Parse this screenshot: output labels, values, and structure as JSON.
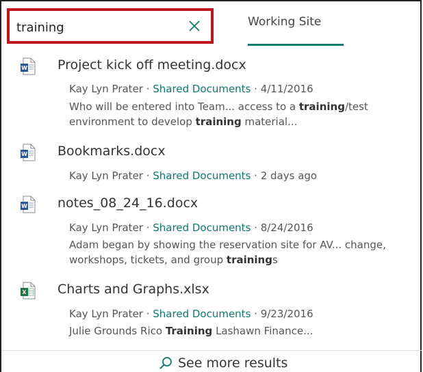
{
  "search": {
    "query": "training"
  },
  "tabs": {
    "working_site": "Working Site"
  },
  "results": [
    {
      "type": "word",
      "title": "Project kick off meeting.docx",
      "author": "Kay Lyn Prater",
      "library": "Shared Documents",
      "date": "4/11/2016",
      "snippet_line1": [
        "Who will be entered into Team... access to a ",
        "training",
        "/test"
      ],
      "snippet_line2": [
        "environment to develop ",
        "training",
        " material..."
      ]
    },
    {
      "type": "word",
      "title": "Bookmarks.docx",
      "author": "Kay Lyn Prater",
      "library": "Shared Documents",
      "date": "2 days ago"
    },
    {
      "type": "word",
      "title": "notes_08_24_16.docx",
      "author": "Kay Lyn Prater",
      "library": "Shared Documents",
      "date": "8/24/2016",
      "snippet_line1": [
        "Adam began by showing the reservation site for AV... change,"
      ],
      "snippet_line2": [
        "workshops, tickets, and group ",
        "training",
        "s"
      ]
    },
    {
      "type": "excel",
      "title": "Charts and Graphs.xlsx",
      "author": "Kay Lyn Prater",
      "library": "Shared Documents",
      "date": "9/23/2016",
      "snippet_line1": [
        "Julie Grounds Rico ",
        "Training",
        " Lashawn Finance..."
      ]
    }
  ],
  "separator": " · ",
  "footer": {
    "see_more": "See more results"
  },
  "colors": {
    "accent": "#0b7a6b",
    "highlight_border": "#c0141f",
    "word_blue": "#2b579a",
    "excel_green": "#217346"
  },
  "icons": {
    "clear": "close-icon",
    "word": "word-doc-icon",
    "excel": "excel-doc-icon",
    "search": "search-icon"
  }
}
